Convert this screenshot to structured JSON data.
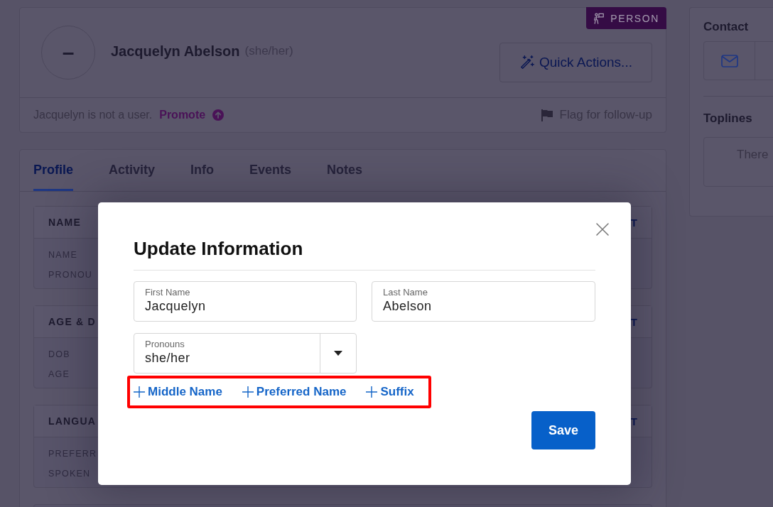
{
  "header": {
    "avatar": "–",
    "name": "Jacquelyn Abelson",
    "pronouns": "(she/her)",
    "badge": "PERSON",
    "quick_actions": "Quick Actions...",
    "status": "Jacquelyn is not a user.",
    "promote": "Promote",
    "flag": "Flag for follow-up"
  },
  "tabs": [
    {
      "label": "Profile",
      "selected": true
    },
    {
      "label": "Activity",
      "selected": false
    },
    {
      "label": "Info",
      "selected": false
    },
    {
      "label": "Events",
      "selected": false
    },
    {
      "label": "Notes",
      "selected": false
    }
  ],
  "sections": [
    {
      "title": "NAME",
      "action": "T",
      "labels": [
        "NAME",
        "PRONOU"
      ]
    },
    {
      "title": "AGE & D",
      "action": "T",
      "labels": [
        "DOB",
        "AGE"
      ]
    },
    {
      "title": "LANGUA",
      "action": "T",
      "labels": [
        "PREFERR",
        "SPOKEN"
      ]
    }
  ],
  "sidebar": {
    "contact_title": "Contact",
    "toplines_title": "Toplines",
    "toplines_text": "There"
  },
  "dialog": {
    "title": "Update Information",
    "fields": [
      {
        "kind": "text",
        "label": "First Name",
        "value": "Jacquelyn"
      },
      {
        "kind": "text",
        "label": "Last Name",
        "value": "Abelson"
      },
      {
        "kind": "select",
        "label": "Pronouns",
        "value": "she/her"
      }
    ],
    "add_links": [
      "Middle Name",
      "Preferred Name",
      "Suffix"
    ],
    "add_links_highlighted": true,
    "save": "Save"
  }
}
